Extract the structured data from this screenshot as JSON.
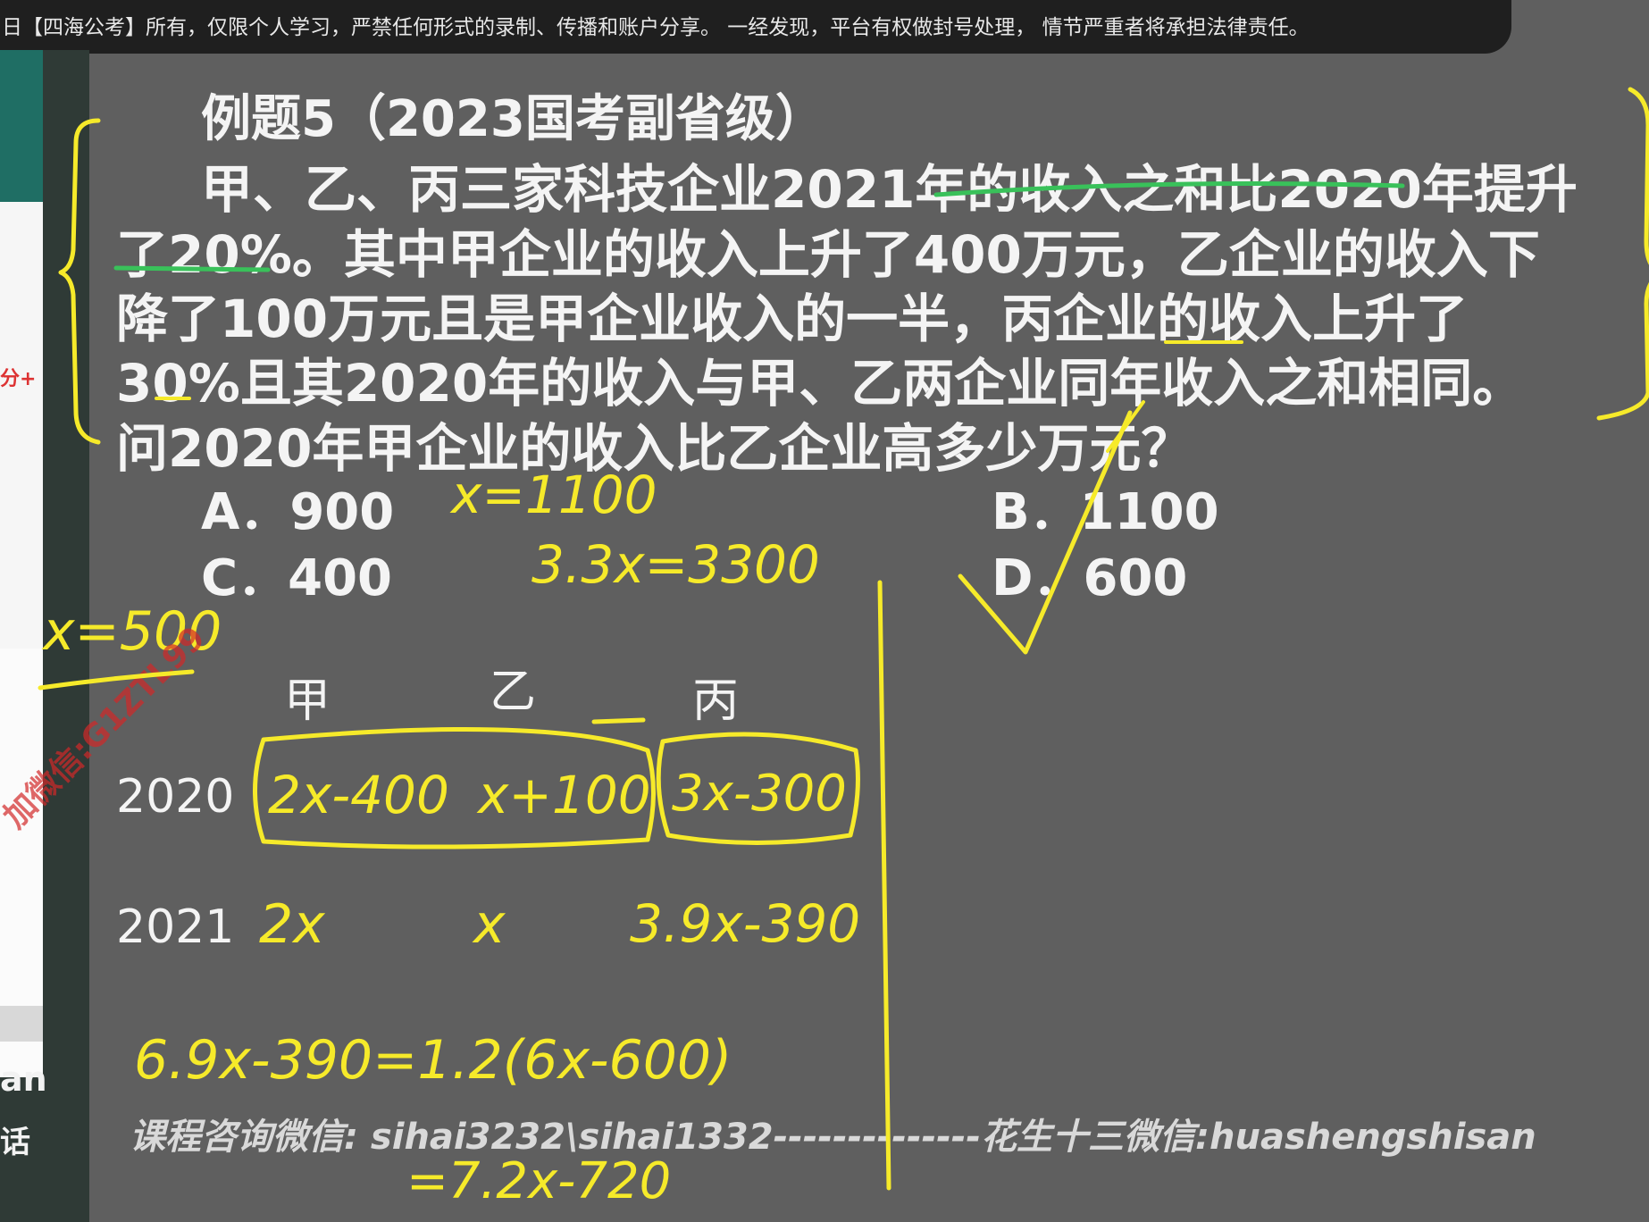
{
  "banner": {
    "text": "日【四海公考】所有，仅限个人学习，严禁任何形式的录制、传播和账户分享。 一经发现，平台有权做封号处理， 情节严重者将承担法律责任。"
  },
  "left_panel": {
    "red_text": "分+",
    "label1": "an",
    "label2": "话"
  },
  "question": {
    "title": "例题5（2023国考副省级）",
    "lines": [
      "甲、乙、丙三家科技企业2021年的收入之和比2020年提升",
      "了20%。其中甲企业的收入上升了400万元，乙企业的收入下",
      "降了100万元且是甲企业收入的一半，丙企业的收入上升了",
      "30%且其2020年的收入与甲、乙两企业同年收入之和相同。",
      "问2020年甲企业的收入比乙企业高多少万元？"
    ],
    "options": {
      "a": "A．900",
      "b": "B．1100",
      "c": "C．400",
      "d": "D．600"
    }
  },
  "table": {
    "headers": [
      "甲",
      "乙",
      "丙"
    ],
    "years": [
      "2020",
      "2021"
    ]
  },
  "handwriting": {
    "eq1": "x=1100",
    "eq2": "3.3x=3300",
    "result": "x=500",
    "row2020": [
      "2x-400",
      "x+100",
      "3x-300"
    ],
    "row2021": [
      "2x",
      "x",
      "3.9x-390"
    ],
    "eq3": "6.9x-390=1.2(6x-600)",
    "eq4": "=7.2x-720"
  },
  "footer": {
    "text": "课程咨询微信: sihai3232\\sihai1332--------------花生十三微信:huashengshisan"
  },
  "watermark": {
    "text": "加微信:G1ZTL99"
  },
  "colors": {
    "background": "#5f5f5f",
    "ink_yellow": "#f6ea2a",
    "ink_green": "#39c15a",
    "text": "#f4f4f4"
  }
}
